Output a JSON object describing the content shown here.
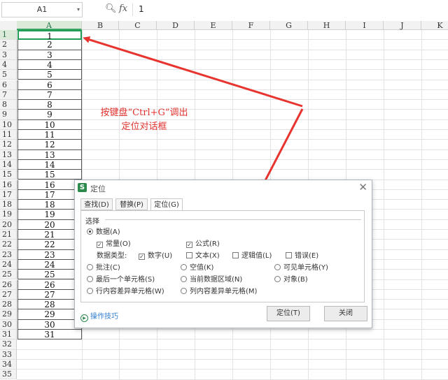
{
  "formula_bar": {
    "name_box": "A1",
    "fx_label": "fx",
    "search_icon": "magnify-icon",
    "value": "1"
  },
  "columns": [
    "A",
    "B",
    "C",
    "D",
    "E",
    "F",
    "G",
    "H",
    "I",
    "J",
    "K"
  ],
  "rows": [
    "1",
    "2",
    "3",
    "4",
    "5",
    "6",
    "7",
    "8",
    "9",
    "10",
    "11",
    "12",
    "13",
    "14",
    "15",
    "16",
    "17",
    "18",
    "19",
    "20",
    "21",
    "22",
    "23",
    "24",
    "25",
    "26",
    "27",
    "28",
    "29",
    "30",
    "31",
    "32",
    "33",
    "34",
    "35"
  ],
  "column_a_values": [
    "1",
    "2",
    "3",
    "4",
    "5",
    "6",
    "7",
    "8",
    "9",
    "10",
    "11",
    "12",
    "13",
    "14",
    "15",
    "16",
    "17",
    "18",
    "19",
    "20",
    "21",
    "22",
    "23",
    "24",
    "25",
    "26",
    "27",
    "28",
    "29",
    "30",
    "31"
  ],
  "annotation": {
    "line1": "按键盘“Ctrl+G”调出",
    "line2": "定位对话框",
    "color": "#e0302c"
  },
  "dialog": {
    "logo": "S",
    "title": "定位",
    "tabs": [
      "查找(D)",
      "替换(P)",
      "定位(G)"
    ],
    "active_tab": "定位(G)",
    "section": "选择",
    "options": {
      "data": "数据(A)",
      "constant": "常量(O)",
      "formula": "公式(R)",
      "data_type": "数据类型:",
      "number": "数字(U)",
      "text": "文本(X)",
      "logical": "逻辑值(L)",
      "error": "错误(E)",
      "comment": "批注(C)",
      "blank": "空值(K)",
      "visible": "可见单元格(Y)",
      "last_cell": "最后一个单元格(S)",
      "current_region": "当前数据区域(N)",
      "object": "对象(B)",
      "row_diff": "行内容差异单元格(W)",
      "col_diff": "列内容差异单元格(M)"
    },
    "help": "操作技巧",
    "locate_button": "定位(T)",
    "close_button": "关闭"
  },
  "colors": {
    "accent": "#1f9d55",
    "header_bg": "#f2f2f2"
  }
}
